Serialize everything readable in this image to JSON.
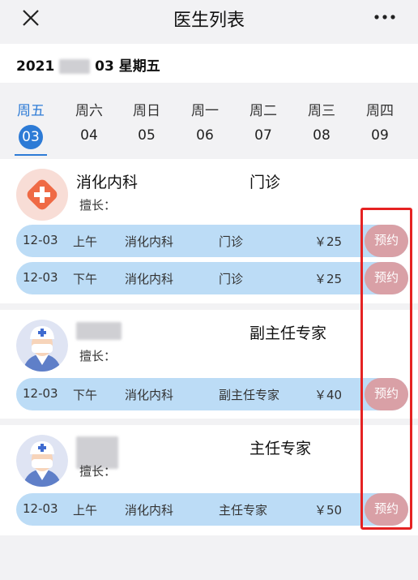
{
  "header": {
    "title": "医生列表"
  },
  "datebar": {
    "date_prefix": "2021",
    "date_suffix": "03 星期五"
  },
  "week": [
    {
      "weekday": "周五",
      "day": "03",
      "active": true
    },
    {
      "weekday": "周六",
      "day": "04"
    },
    {
      "weekday": "周日",
      "day": "05"
    },
    {
      "weekday": "周一",
      "day": "06"
    },
    {
      "weekday": "周二",
      "day": "07"
    },
    {
      "weekday": "周三",
      "day": "08"
    },
    {
      "weekday": "周四",
      "day": "09"
    }
  ],
  "doctors": [
    {
      "name": "消化内科",
      "type": "门诊",
      "skill_label": "擅长：",
      "slots": [
        {
          "date": "12-03",
          "period": "上午",
          "dept": "消化内科",
          "type": "门诊",
          "price": "￥25",
          "book": "预约"
        },
        {
          "date": "12-03",
          "period": "下午",
          "dept": "消化内科",
          "type": "门诊",
          "price": "￥25",
          "book": "预约"
        }
      ]
    },
    {
      "name": "",
      "type": "副主任专家",
      "skill_label": "擅长：",
      "slots": [
        {
          "date": "12-03",
          "period": "下午",
          "dept": "消化内科",
          "type": "副主任专家",
          "price": "￥40",
          "book": "预约"
        }
      ]
    },
    {
      "name": "",
      "type": "主任专家",
      "skill_label": "擅长：",
      "slots": [
        {
          "date": "12-03",
          "period": "上午",
          "dept": "消化内科",
          "type": "主任专家",
          "price": "￥50",
          "book": "预约"
        }
      ]
    }
  ],
  "colors": {
    "accent": "#2d7bd6",
    "slot_bg": "#bcdcf6",
    "book_bg": "#d9a0a6",
    "highlight": "#e52222"
  }
}
